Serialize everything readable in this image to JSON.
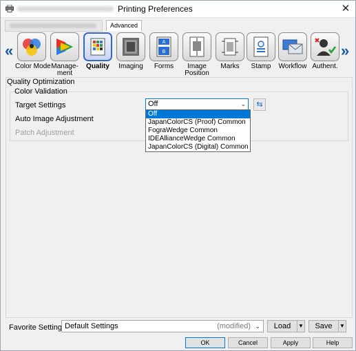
{
  "window": {
    "title": "Printing Preferences",
    "close": "✕"
  },
  "tabs": {
    "advanced": "Advanced"
  },
  "nav": {
    "left": "«",
    "right": "»"
  },
  "iconbar": [
    {
      "label": "Color Mode"
    },
    {
      "label": "Manage-\nment"
    },
    {
      "label": "Quality"
    },
    {
      "label": "Imaging"
    },
    {
      "label": "Forms"
    },
    {
      "label": "Image\nPosition"
    },
    {
      "label": "Marks"
    },
    {
      "label": "Stamp"
    },
    {
      "label": "Workflow"
    },
    {
      "label": "Authent."
    }
  ],
  "panel": {
    "section_title": "Quality Optimization",
    "group_title": "Color Validation",
    "target_label": "Target Settings",
    "target_value": "Off",
    "auto_label": "Auto Image Adjustment",
    "patch_label": "Patch Adjustment",
    "dropdown_options": [
      "Off",
      "JapanColorCS (Proof) Common",
      "FograWedge Common",
      "IDEAllianceWedge Common",
      "JapanColorCS (Digital) Common"
    ]
  },
  "favorite": {
    "label": "Favorite Setting",
    "value": "Default Settings",
    "modified": "(modified)",
    "load": "Load",
    "save": "Save"
  },
  "buttons": {
    "ok": "OK",
    "cancel": "Cancel",
    "apply": "Apply",
    "help": "Help"
  },
  "colors": {
    "accent": "#0078d7",
    "selected_border": "#3a67c6",
    "nav_arrow": "#1a5aa8"
  }
}
